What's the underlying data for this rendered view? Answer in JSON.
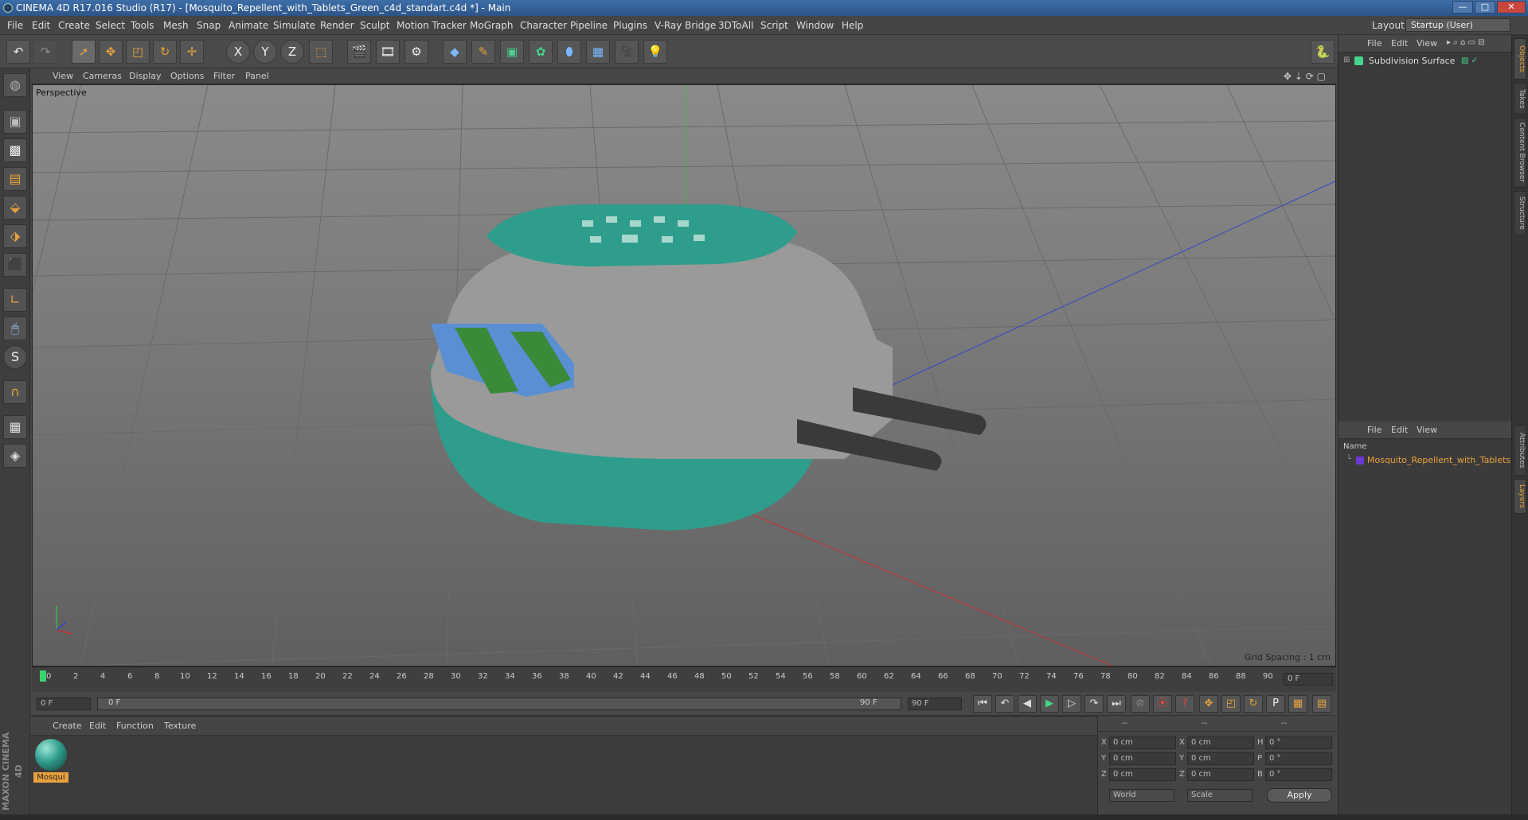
{
  "window": {
    "title": "CINEMA 4D R17.016 Studio (R17) - [Mosquito_Repellent_with_Tablets_Green_c4d_standart.c4d *] - Main",
    "minimize": "—",
    "maximize": "□",
    "close": "✕"
  },
  "menubar": {
    "items": [
      "File",
      "Edit",
      "Create",
      "Select",
      "Tools",
      "Mesh",
      "Snap",
      "Animate",
      "Simulate",
      "Render",
      "Sculpt",
      "Motion Tracker",
      "MoGraph",
      "Character",
      "Pipeline",
      "Plugins",
      "V-Ray Bridge",
      "3DToAll",
      "Script",
      "Window",
      "Help"
    ],
    "layout_label": "Layout:",
    "layout_value": "Startup (User)"
  },
  "toolbar": {
    "axis_x": "X",
    "axis_y": "Y",
    "axis_z": "Z"
  },
  "viewport": {
    "menu": [
      "View",
      "Cameras",
      "Display",
      "Options",
      "Filter",
      "Panel"
    ],
    "camera_label": "Perspective",
    "grid_spacing": "Grid Spacing : 1 cm"
  },
  "timeline": {
    "ticks": [
      "0",
      "2",
      "4",
      "6",
      "8",
      "10",
      "12",
      "14",
      "16",
      "18",
      "20",
      "22",
      "24",
      "26",
      "28",
      "30",
      "32",
      "34",
      "36",
      "38",
      "40",
      "42",
      "44",
      "46",
      "48",
      "50",
      "52",
      "54",
      "56",
      "58",
      "60",
      "62",
      "64",
      "66",
      "68",
      "70",
      "72",
      "74",
      "76",
      "78",
      "80",
      "82",
      "84",
      "86",
      "88",
      "90"
    ],
    "current_frame": "0 F",
    "start_field": "0 F",
    "range_start": "0 F",
    "range_end": "90 F",
    "end_field": "90 F"
  },
  "material_manager": {
    "menu": [
      "Create",
      "Edit",
      "Function",
      "Texture"
    ],
    "material_name": "Mosqui"
  },
  "coordinates": {
    "header": [
      "--",
      "--",
      "--"
    ],
    "rows": [
      {
        "a": "X",
        "a_val": "0 cm",
        "b": "X",
        "b_val": "0 cm",
        "c": "H",
        "c_val": "0 °"
      },
      {
        "a": "Y",
        "a_val": "0 cm",
        "b": "Y",
        "b_val": "0 cm",
        "c": "P",
        "c_val": "0 °"
      },
      {
        "a": "Z",
        "a_val": "0 cm",
        "b": "Z",
        "b_val": "0 cm",
        "c": "B",
        "c_val": "0 °"
      }
    ],
    "world_select": "World",
    "scale_select": "Scale",
    "apply_label": "Apply"
  },
  "objects_panel": {
    "menu": [
      "File",
      "Edit",
      "View"
    ],
    "object_name": "Subdivision Surface"
  },
  "layers_panel": {
    "menu": [
      "File",
      "Edit",
      "View"
    ],
    "column_name": "Name",
    "item_name": "Mosquito_Repellent_with_Tablets"
  },
  "side_tabs": [
    "Objects",
    "Takes",
    "Content Browser",
    "Structure",
    "Attributes",
    "Layers"
  ],
  "maxon_logo": "MAXON CINEMA 4D",
  "colors": {
    "accent_orange": "#e8a23c",
    "body_teal": "#2f9d8c",
    "shell_gray": "#9a9a9a",
    "layer_text": "#e8a23c"
  }
}
